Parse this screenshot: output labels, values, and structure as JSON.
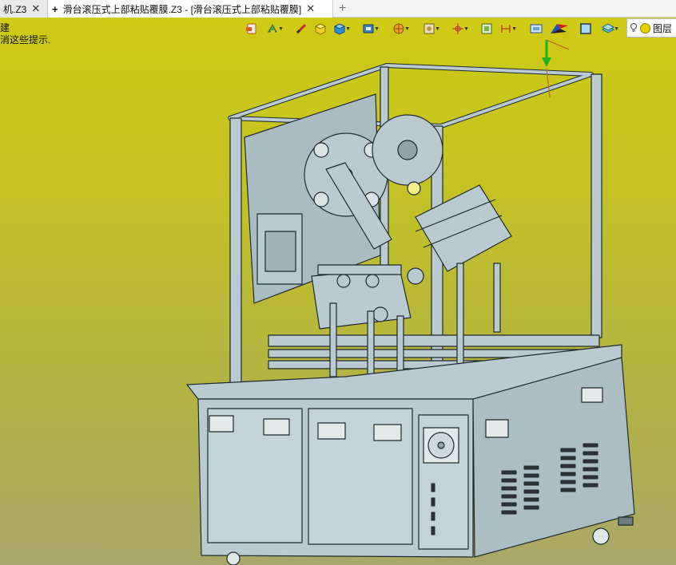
{
  "tabs": {
    "left_tab": {
      "label": "机.Z3",
      "close": "✕"
    },
    "active_tab": {
      "pin": "+",
      "label": "滑台滚压式上部粘贴覆膜.Z3 - [滑台滚压式上部粘贴覆膜]",
      "close": "✕"
    },
    "new_tab": "+"
  },
  "viewport": {
    "prompt_line1": "建",
    "prompt_line2": "消这些提示."
  },
  "toolbar": {
    "icons": [
      "open-icon",
      "paint-icon",
      "pen-icon",
      "cube-yellow-icon",
      "cube-blue-icon",
      "cube-display-icon",
      "sphere-icon",
      "render-icon",
      "origin-icon",
      "frame-icon",
      "dimension-icon",
      "view-icon",
      "colored-flag-icon",
      "square-icon",
      "layers-icon"
    ],
    "layer_label": "图层"
  },
  "colors": {
    "viewport_top": "#cfca14",
    "viewport_bottom": "#a9a768",
    "model_fill": "#b9cbd0",
    "model_line": "#1f2a2e"
  }
}
